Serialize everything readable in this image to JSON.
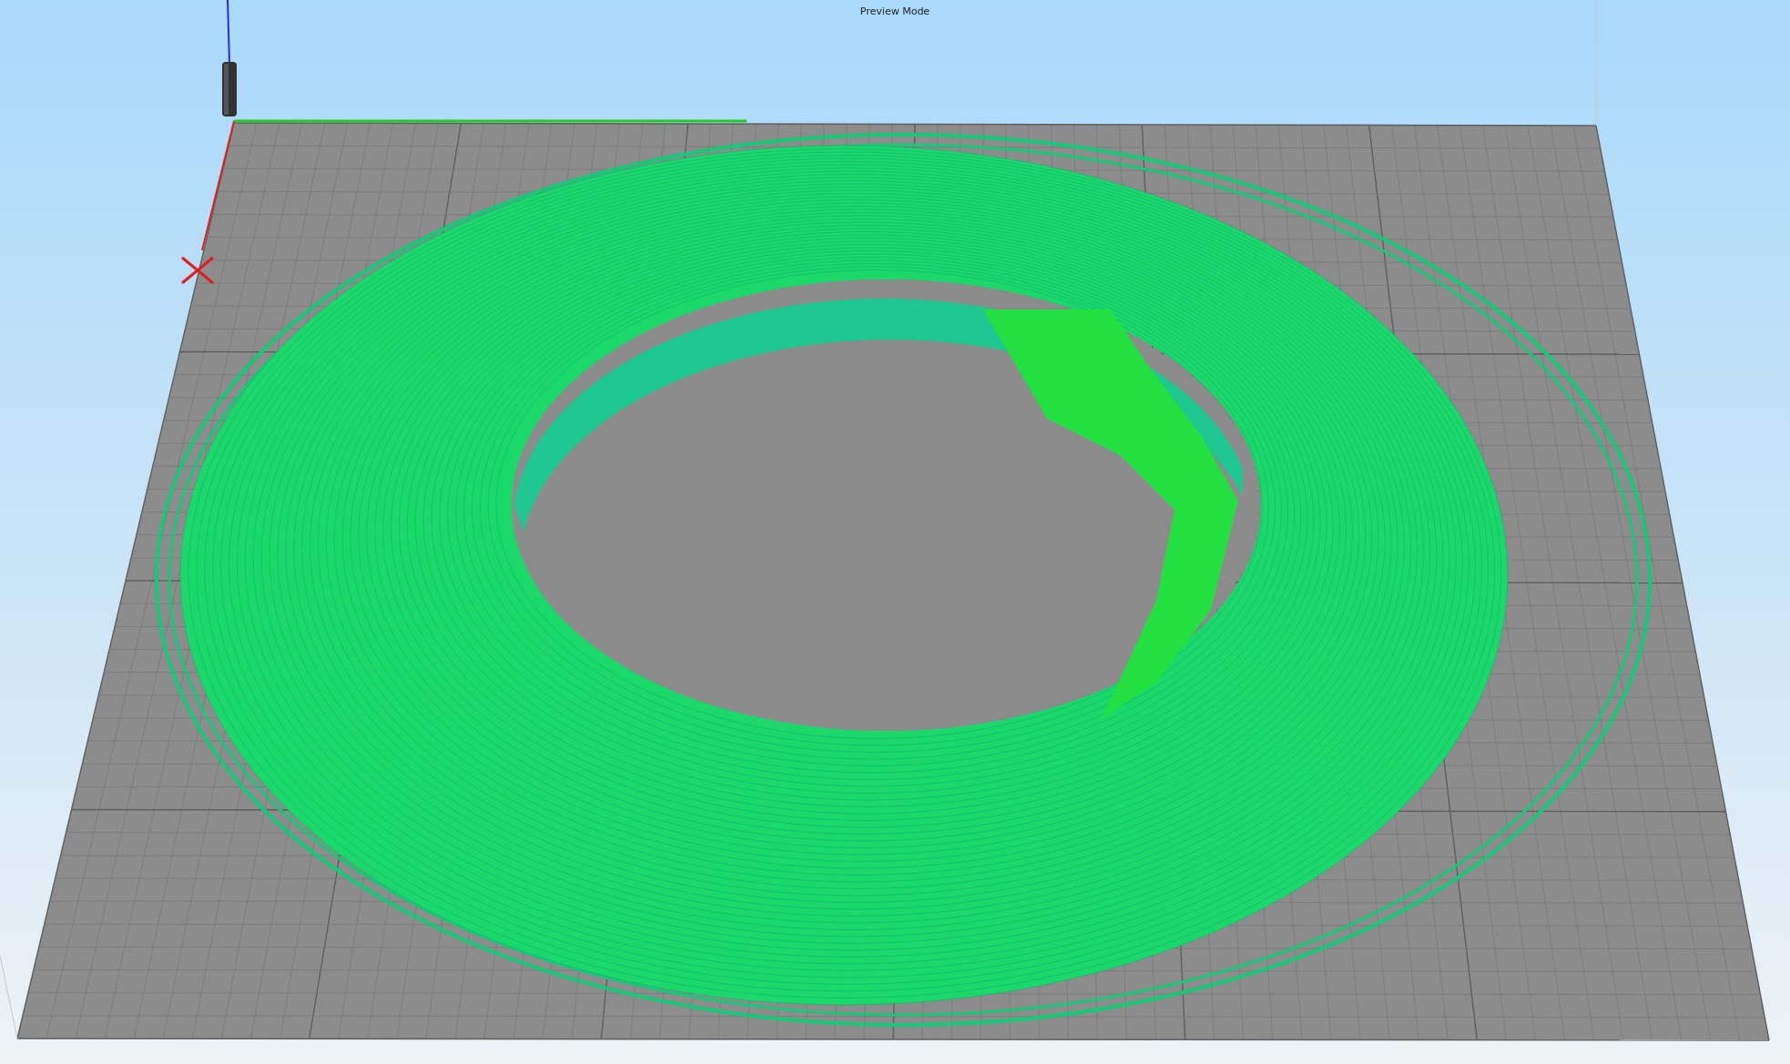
{
  "viewport": {
    "mode_label": "Preview Mode"
  }
}
